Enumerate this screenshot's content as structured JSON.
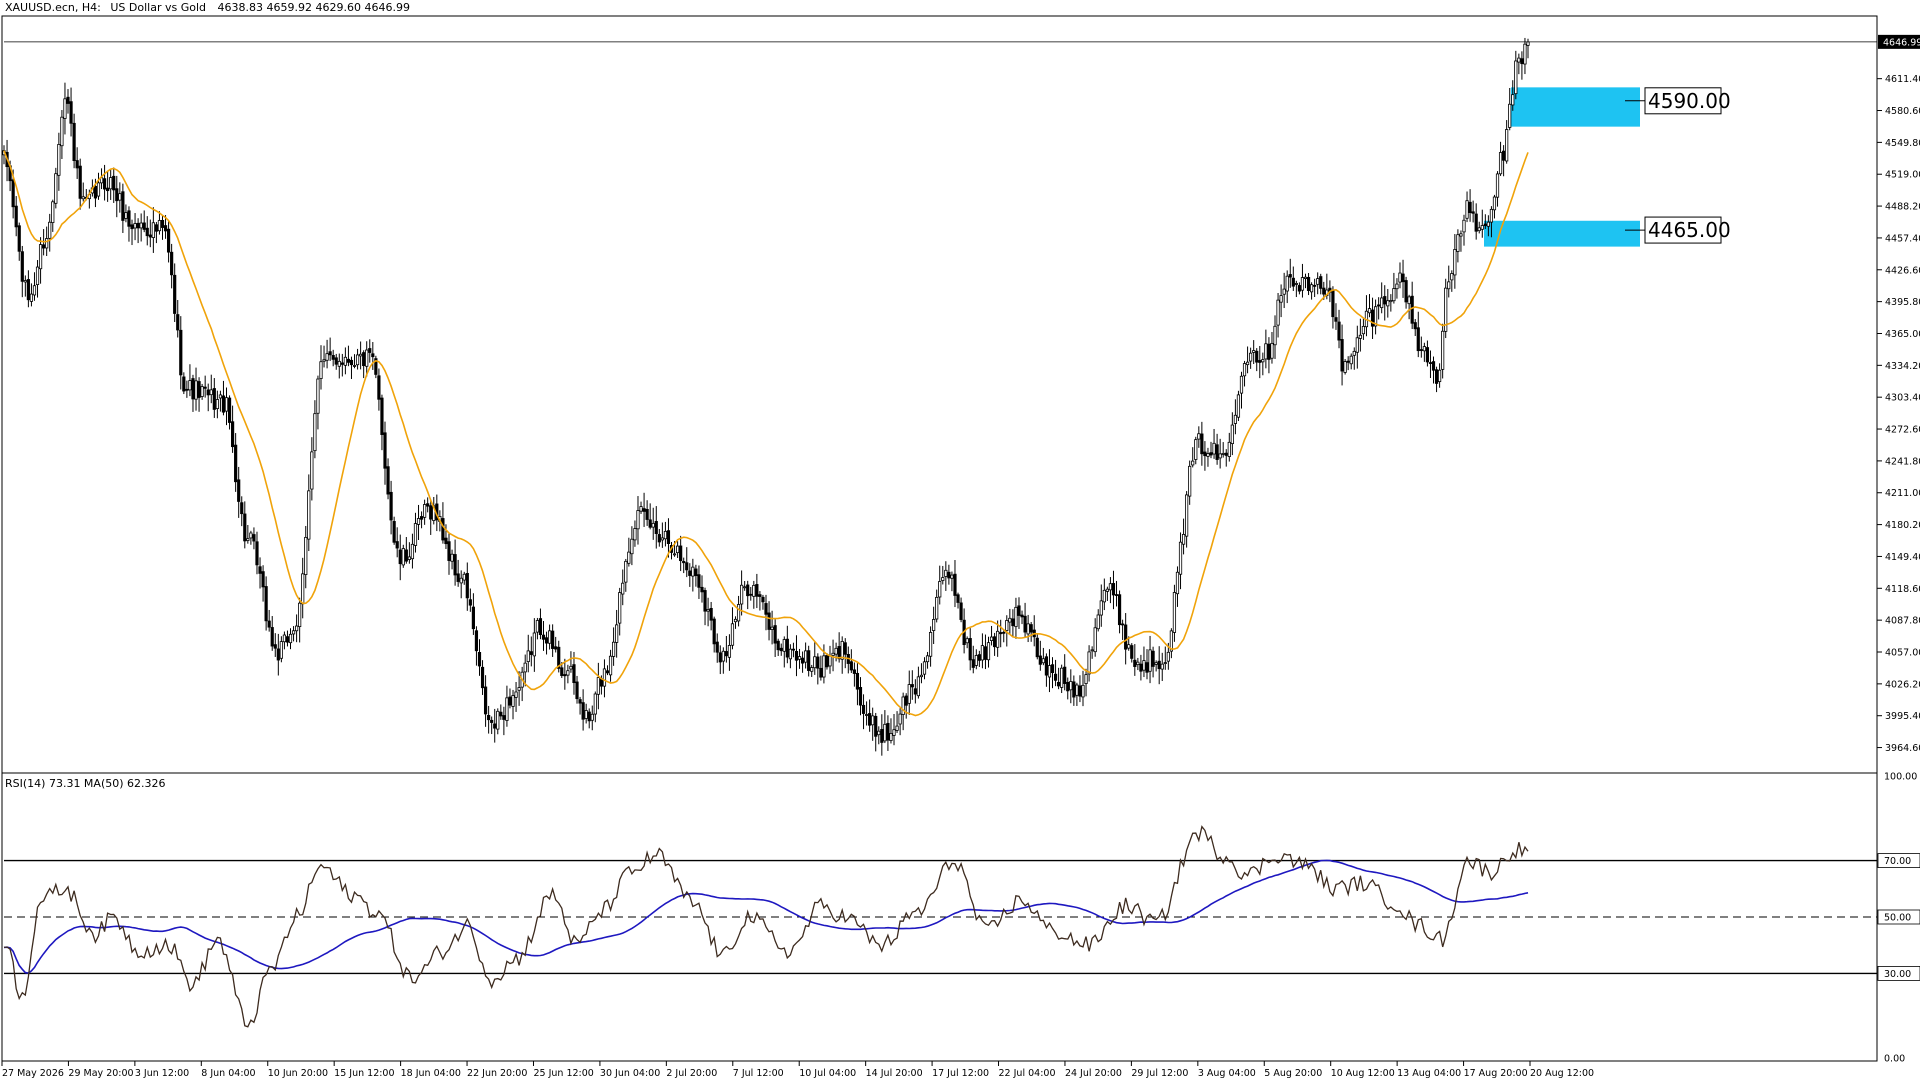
{
  "header": {
    "symbol": "XAUUSD.ecn, H4:",
    "description": "US Dollar vs Gold",
    "ohlc": "4638.83 4659.92 4629.60 4646.99"
  },
  "price_axis_ticks": [
    "4611.40",
    "4580.60",
    "4549.80",
    "4519.00",
    "4488.20",
    "4457.40",
    "4426.60",
    "4395.80",
    "4365.00",
    "4334.20",
    "4303.40",
    "4272.60",
    "4241.80",
    "4211.00",
    "4180.20",
    "4149.40",
    "4118.60",
    "4087.80",
    "4057.00",
    "4026.20",
    "3995.40",
    "3964.60"
  ],
  "current_price": "4646.99",
  "rsi_header": "RSI(14) 73.31 MA(50) 62.326",
  "rsi_axis_ticks": [
    "100.00",
    "70.00",
    "50.00",
    "30.00",
    "0.00"
  ],
  "time_axis_labels": [
    "27 May 2026",
    "29 May 20:00",
    "3 Jun 12:00",
    "8 Jun 04:00",
    "10 Jun 20:00",
    "15 Jun 12:00",
    "18 Jun 04:00",
    "22 Jun 20:00",
    "25 Jun 12:00",
    "30 Jun 04:00",
    "2 Jul 20:00",
    "7 Jul 12:00",
    "10 Jul 04:00",
    "14 Jul 20:00",
    "17 Jul 12:00",
    "22 Jul 04:00",
    "24 Jul 20:00",
    "29 Jul 12:00",
    "3 Aug 04:00",
    "5 Aug 20:00",
    "10 Aug 12:00",
    "13 Aug 04:00",
    "17 Aug 20:00",
    "20 Aug 12:00"
  ],
  "levels": [
    {
      "label": "4590.00",
      "value": 4590.0,
      "zone_top": 4603,
      "zone_bottom": 4565
    },
    {
      "label": "4465.00",
      "value": 4465.0,
      "zone_top": 4474,
      "zone_bottom": 4449
    }
  ],
  "colors": {
    "candle": "#000000",
    "ma": "#f0a30a",
    "rsi": "#3d2b1f",
    "rsi_ma": "#1e18c0",
    "zone": "#1ec3f2",
    "grid_frame": "#000000"
  },
  "chart_data": [
    {
      "type": "candlestick",
      "title": "XAUUSD.ecn, H4: US Dollar vs Gold",
      "ylim": [
        3940,
        4672
      ],
      "anchors": [
        [
          0,
          4532
        ],
        [
          8,
          4400
        ],
        [
          14,
          4460
        ],
        [
          20,
          4592
        ],
        [
          26,
          4488
        ],
        [
          34,
          4512
        ],
        [
          42,
          4470
        ],
        [
          52,
          4465
        ],
        [
          60,
          4312
        ],
        [
          72,
          4298
        ],
        [
          80,
          4165
        ],
        [
          90,
          4055
        ],
        [
          96,
          4085
        ],
        [
          104,
          4335
        ],
        [
          110,
          4342
        ],
        [
          120,
          4340
        ],
        [
          130,
          4145
        ],
        [
          140,
          4196
        ],
        [
          150,
          4128
        ],
        [
          160,
          3985
        ],
        [
          168,
          4018
        ],
        [
          176,
          4082
        ],
        [
          184,
          4040
        ],
        [
          192,
          3990
        ],
        [
          196,
          4032
        ],
        [
          208,
          4188
        ],
        [
          216,
          4172
        ],
        [
          226,
          4135
        ],
        [
          236,
          4055
        ],
        [
          244,
          4122
        ],
        [
          256,
          4060
        ],
        [
          268,
          4042
        ],
        [
          276,
          4060
        ],
        [
          284,
          3985
        ],
        [
          290,
          3978
        ],
        [
          298,
          4020
        ],
        [
          310,
          4132
        ],
        [
          318,
          4048
        ],
        [
          332,
          4092
        ],
        [
          344,
          4035
        ],
        [
          352,
          4022
        ],
        [
          362,
          4118
        ],
        [
          372,
          4045
        ],
        [
          380,
          4052
        ],
        [
          392,
          4258
        ],
        [
          400,
          4245
        ],
        [
          408,
          4348
        ],
        [
          414,
          4345
        ],
        [
          420,
          4415
        ],
        [
          428,
          4410
        ],
        [
          434,
          4412
        ],
        [
          440,
          4330
        ],
        [
          448,
          4382
        ],
        [
          458,
          4415
        ],
        [
          466,
          4345
        ],
        [
          470,
          4325
        ],
        [
          474,
          4418
        ],
        [
          480,
          4485
        ],
        [
          486,
          4460
        ],
        [
          492,
          4540
        ],
        [
          496,
          4618
        ],
        [
          500,
          4646.99
        ]
      ],
      "last_close": 4646.99,
      "moving_average": {
        "period": 20,
        "color": "#f0a30a"
      },
      "levels": [
        4590.0,
        4465.0
      ]
    },
    {
      "type": "line",
      "title": "RSI(14) 73.31 MA(50) 62.326",
      "ylim": [
        0,
        100
      ],
      "series": [
        {
          "name": "RSI(14)",
          "last": 73.31
        },
        {
          "name": "MA(50)",
          "last": 62.326
        }
      ],
      "anchors": [
        [
          0,
          42
        ],
        [
          6,
          22
        ],
        [
          12,
          56
        ],
        [
          20,
          60
        ],
        [
          30,
          44
        ],
        [
          36,
          50
        ],
        [
          44,
          38
        ],
        [
          54,
          40
        ],
        [
          62,
          26
        ],
        [
          70,
          42
        ],
        [
          80,
          12
        ],
        [
          88,
          32
        ],
        [
          96,
          50
        ],
        [
          104,
          68
        ],
        [
          114,
          58
        ],
        [
          122,
          52
        ],
        [
          134,
          28
        ],
        [
          144,
          38
        ],
        [
          152,
          47
        ],
        [
          160,
          28
        ],
        [
          168,
          35
        ],
        [
          180,
          58
        ],
        [
          188,
          40
        ],
        [
          196,
          52
        ],
        [
          206,
          66
        ],
        [
          214,
          72
        ],
        [
          226,
          55
        ],
        [
          236,
          36
        ],
        [
          244,
          50
        ],
        [
          258,
          38
        ],
        [
          268,
          54
        ],
        [
          276,
          50
        ],
        [
          288,
          40
        ],
        [
          300,
          52
        ],
        [
          312,
          70
        ],
        [
          322,
          45
        ],
        [
          334,
          56
        ],
        [
          344,
          45
        ],
        [
          356,
          40
        ],
        [
          368,
          54
        ],
        [
          378,
          48
        ],
        [
          392,
          80
        ],
        [
          400,
          72
        ],
        [
          408,
          65
        ],
        [
          418,
          72
        ],
        [
          428,
          68
        ],
        [
          436,
          60
        ],
        [
          446,
          62
        ],
        [
          456,
          55
        ],
        [
          464,
          47
        ],
        [
          472,
          42
        ],
        [
          480,
          70
        ],
        [
          488,
          66
        ],
        [
          496,
          74
        ],
        [
          500,
          73.31
        ]
      ],
      "reference_lines": [
        70,
        50,
        30
      ]
    }
  ]
}
